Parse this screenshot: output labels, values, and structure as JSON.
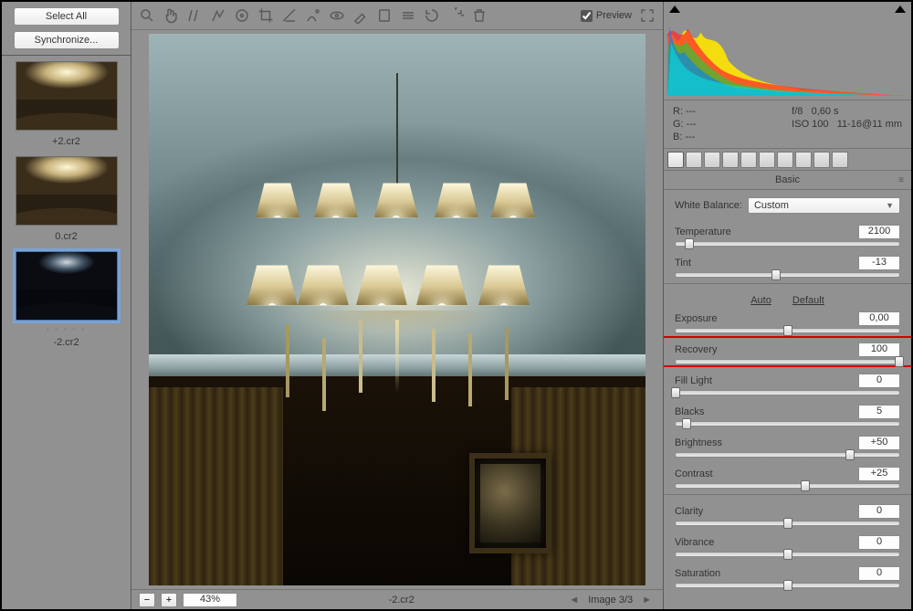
{
  "left": {
    "select_all": "Select All",
    "synchronize": "Synchronize...",
    "thumbs": [
      {
        "label": "+2.cr2"
      },
      {
        "label": "0.cr2"
      },
      {
        "label": "-2.cr2"
      }
    ]
  },
  "toolbar": {
    "preview_label": "Preview",
    "preview_checked": true
  },
  "statusbar": {
    "zoom": "43%",
    "filename": "-2.cr2",
    "image_index": "Image 3/3"
  },
  "exif": {
    "r": "R:   ---",
    "g": "G:   ---",
    "b": "B:   ---",
    "aperture": "f/8",
    "shutter": "0,60 s",
    "iso": "ISO 100",
    "lens": "11-16@11 mm"
  },
  "panels": {
    "basic_title": "Basic",
    "wb_label": "White Balance:",
    "wb_value": "Custom",
    "auto": "Auto",
    "default": "Default",
    "sliders": {
      "temperature": {
        "label": "Temperature",
        "value": "2100",
        "pos": 6
      },
      "tint": {
        "label": "Tint",
        "value": "-13",
        "pos": 45
      },
      "exposure": {
        "label": "Exposure",
        "value": "0,00",
        "pos": 50
      },
      "recovery": {
        "label": "Recovery",
        "value": "100",
        "pos": 100
      },
      "filllight": {
        "label": "Fill Light",
        "value": "0",
        "pos": 0
      },
      "blacks": {
        "label": "Blacks",
        "value": "5",
        "pos": 5
      },
      "brightness": {
        "label": "Brightness",
        "value": "+50",
        "pos": 78
      },
      "contrast": {
        "label": "Contrast",
        "value": "+25",
        "pos": 58
      },
      "clarity": {
        "label": "Clarity",
        "value": "0",
        "pos": 50
      },
      "vibrance": {
        "label": "Vibrance",
        "value": "0",
        "pos": 50
      },
      "saturation": {
        "label": "Saturation",
        "value": "0",
        "pos": 50
      }
    }
  }
}
